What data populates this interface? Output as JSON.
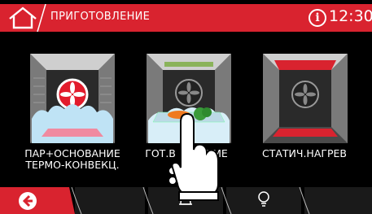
{
  "header": {
    "title": "ПРИГОТОВЛЕНИЕ",
    "info_icon": "info-icon",
    "time": "12:30",
    "home_icon": "home-icon",
    "accent": "#d9232f"
  },
  "programs": [
    {
      "label": "ПАР+ОСНОВАНИЕ\nТЕРМО-КОНВЕКЦ.",
      "icon": "steam-fan-bottom-oven-icon",
      "selected": false
    },
    {
      "label": "ГОТ.В ВАКУУМЕ",
      "icon": "sous-vide-oven-icon",
      "selected": true
    },
    {
      "label": "СТАТИЧ.НАГРЕВ",
      "icon": "static-heat-oven-icon",
      "selected": false
    }
  ],
  "bottom_nav": {
    "back_icon": "back-arrow-icon",
    "alarm_icon": "bell-icon",
    "light_icon": "lightbulb-icon"
  }
}
